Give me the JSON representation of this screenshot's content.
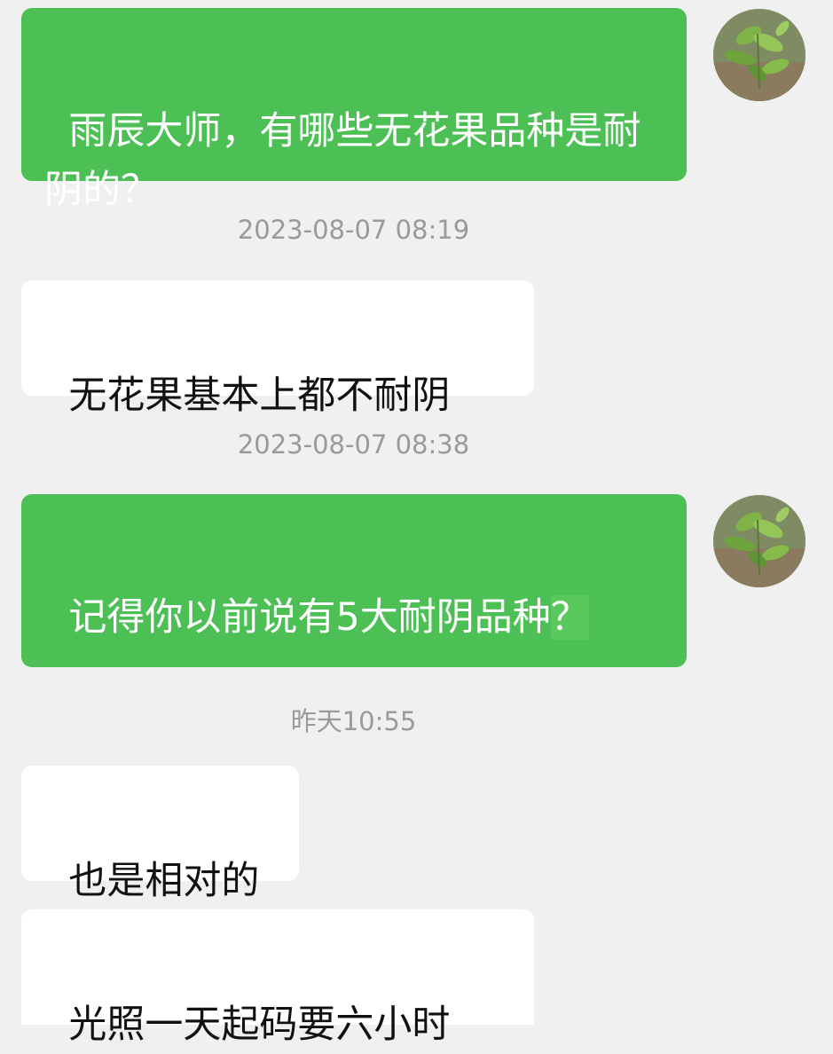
{
  "conversation": {
    "messages": [
      {
        "side": "sent",
        "text_before": "雨辰大师，有哪些无花果品种是耐阴的？",
        "highlight": ""
      },
      {
        "side": "sent",
        "text_before": "记得你以前说有5大耐阴品种",
        "highlight": "？"
      }
    ],
    "timestamps": [
      "2023-08-07 08:19",
      "2023-08-07 08:38",
      "昨天10:55"
    ],
    "replies": [
      "无花果基本上都不耐阴",
      "也是相对的",
      "光照一天起码要六小时"
    ]
  },
  "icons": {
    "avatar": "plant-photo-avatar"
  },
  "colors": {
    "sent_bubble": "#4cbf55",
    "received_bubble": "#ffffff",
    "background": "#f0f0f0",
    "timestamp": "#9a9a9a"
  }
}
